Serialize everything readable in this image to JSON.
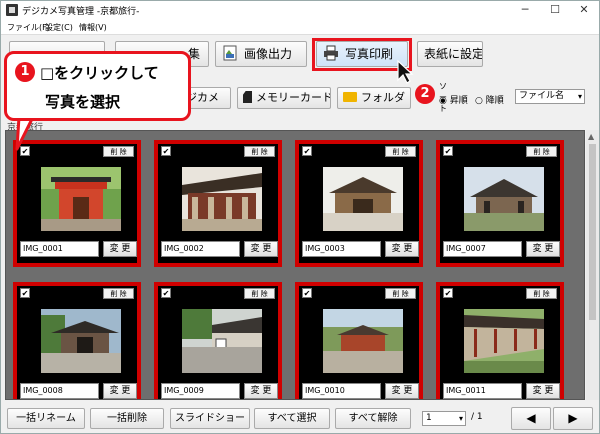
{
  "window": {
    "title": "デジカメ写真管理 -京都旅行-",
    "minimize_glyph": "─",
    "maximize_glyph": "☐",
    "close_glyph": "✕"
  },
  "menu": [
    "ファイル(F)",
    "設定(C)",
    "情報(V)"
  ],
  "toolbar": {
    "partial_label": "集",
    "image_output_label": "画像出力",
    "photo_print_label": "写真印刷",
    "cover_setting_label": "表紙に設定"
  },
  "source": {
    "camera_label": "デジカメ",
    "memory_card_label": "メモリーカード",
    "folder_label": "フォルダ"
  },
  "sort": {
    "heading": "ソート",
    "asc_label": "昇順",
    "desc_label": "降順",
    "field_value": "ファイル名"
  },
  "callout": {
    "step_number": "1",
    "line1": "□をクリックして",
    "line2": "写真を選択",
    "step2_number": "2"
  },
  "group_label": "京都旅行",
  "cards": [
    {
      "name": "IMG_0001",
      "checked": true,
      "delete_label": "削 除",
      "change_label": "変 更",
      "photo": "gate-icon"
    },
    {
      "name": "IMG_0002",
      "checked": true,
      "delete_label": "削 除",
      "change_label": "変 更",
      "photo": "hall-icon"
    },
    {
      "name": "IMG_0003",
      "checked": true,
      "delete_label": "削 除",
      "change_label": "変 更",
      "photo": "temple-icon"
    },
    {
      "name": "IMG_0007",
      "checked": true,
      "delete_label": "削 除",
      "change_label": "変 更",
      "photo": "pavilion-icon"
    },
    {
      "name": "IMG_0008",
      "checked": true,
      "delete_label": "削 除",
      "change_label": "変 更",
      "photo": "gate2-icon"
    },
    {
      "name": "IMG_0009",
      "checked": true,
      "delete_label": "削 除",
      "change_label": "変 更",
      "photo": "courtyard-icon"
    },
    {
      "name": "IMG_0010",
      "checked": true,
      "delete_label": "削 除",
      "change_label": "変 更",
      "photo": "shrine-icon"
    },
    {
      "name": "IMG_0011",
      "checked": true,
      "delete_label": "削 除",
      "change_label": "変 更",
      "photo": "corridor-icon"
    }
  ],
  "bottom": {
    "rename_all": "一括リネーム",
    "delete_all": "一括削除",
    "slideshow": "スライドショー",
    "select_all": "すべて選択",
    "deselect_all": "すべて解除",
    "page_value": "1",
    "page_total": "/ 1",
    "prev_glyph": "◀",
    "next_glyph": "▶"
  },
  "colors": {
    "accent_red": "#e8141e",
    "card_border": "#d00000",
    "gallery_bg": "#6e6e6e"
  }
}
